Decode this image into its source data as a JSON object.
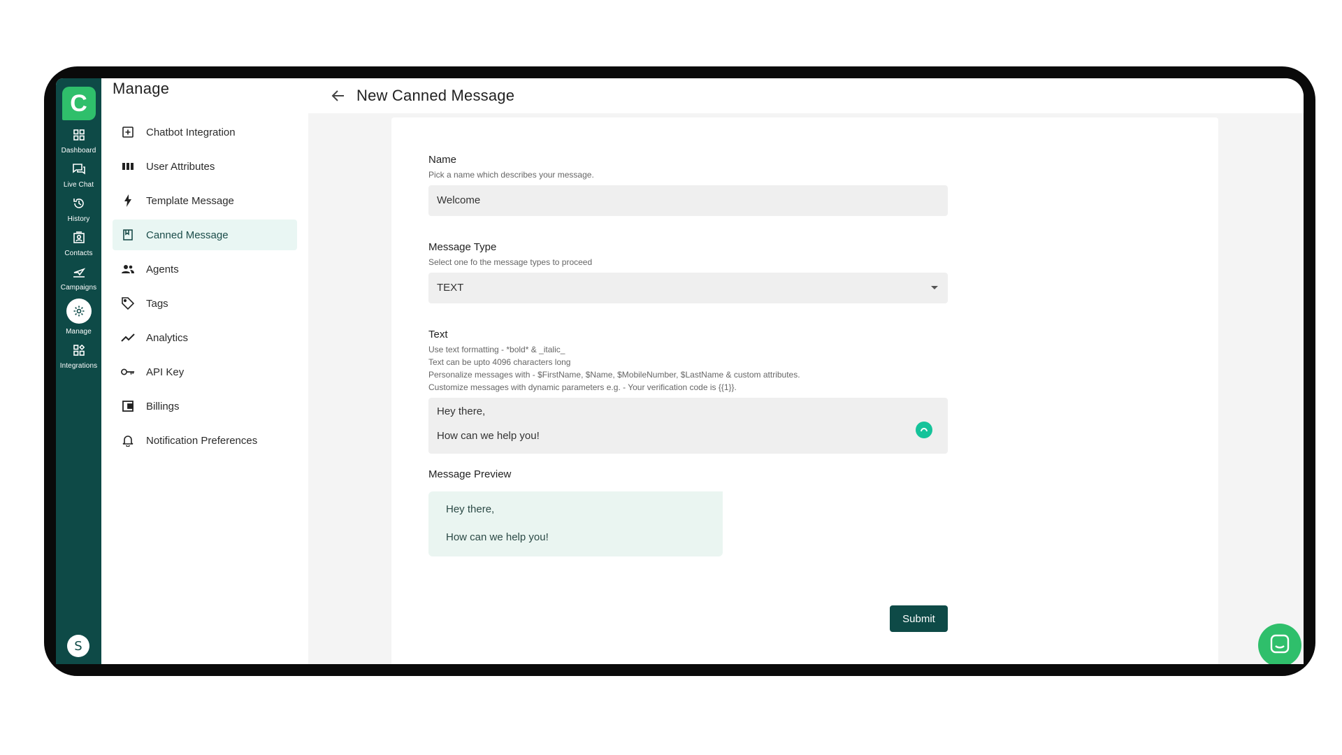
{
  "rail": {
    "items": [
      {
        "label": "Dashboard",
        "icon": "dashboard-icon"
      },
      {
        "label": "Live Chat",
        "icon": "live-chat-icon"
      },
      {
        "label": "History",
        "icon": "history-icon"
      },
      {
        "label": "Contacts",
        "icon": "contacts-icon"
      },
      {
        "label": "Campaigns",
        "icon": "campaigns-icon"
      },
      {
        "label": "Manage",
        "icon": "gear-icon",
        "active": true
      },
      {
        "label": "Integrations",
        "icon": "integrations-icon"
      }
    ],
    "avatar_letter": "S"
  },
  "manage": {
    "title": "Manage",
    "items": [
      {
        "label": "Chatbot Integration",
        "icon": "chatbot-icon"
      },
      {
        "label": "User Attributes",
        "icon": "columns-icon"
      },
      {
        "label": "Template Message",
        "icon": "bolt-icon"
      },
      {
        "label": "Canned Message",
        "icon": "bookmark-icon",
        "active": true
      },
      {
        "label": "Agents",
        "icon": "agents-icon"
      },
      {
        "label": "Tags",
        "icon": "tag-icon"
      },
      {
        "label": "Analytics",
        "icon": "analytics-icon"
      },
      {
        "label": "API Key",
        "icon": "key-icon"
      },
      {
        "label": "Billings",
        "icon": "wallet-icon"
      },
      {
        "label": "Notification Preferences",
        "icon": "bell-icon"
      }
    ]
  },
  "header": {
    "title": "New Canned Message"
  },
  "form": {
    "name": {
      "label": "Name",
      "help": "Pick a name which describes your message.",
      "value": "Welcome"
    },
    "message_type": {
      "label": "Message Type",
      "help": "Select one fo the message types to proceed",
      "value": "TEXT"
    },
    "text": {
      "label": "Text",
      "help_lines": [
        "Use text formatting - *bold* & _italic_",
        "Text can be upto 4096 characters long",
        "Personalize messages with - $FirstName, $Name, $MobileNumber, $LastName & custom attributes.",
        "Customize messages with dynamic parameters e.g. - Your verification code is {{1}}."
      ],
      "lines": [
        "Hey there,",
        "How can we help you!"
      ]
    },
    "preview": {
      "label": "Message Preview",
      "lines": [
        "Hey there,",
        "How can we help you!"
      ]
    },
    "submit_label": "Submit"
  },
  "colors": {
    "brand_dark": "#0e4a47",
    "brand_green": "#2fbf6b",
    "active_bg": "#e9f6f3"
  }
}
